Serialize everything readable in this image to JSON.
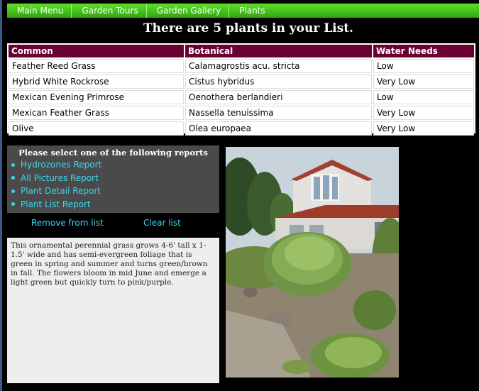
{
  "nav": {
    "items": [
      "Main Menu",
      "Garden Tours",
      "Garden Gallery",
      "Plants"
    ]
  },
  "headline": "There are 5 plants in your List.",
  "table": {
    "headers": [
      "Common",
      "Botanical",
      "Water Needs"
    ],
    "rows": [
      [
        "Feather Reed Grass",
        "Calamagrostis acu. stricta",
        "Low"
      ],
      [
        "Hybrid White Rockrose",
        "Cistus hybridus",
        "Very Low"
      ],
      [
        "Mexican Evening Primrose",
        "Oenothera berlandieri",
        "Low"
      ],
      [
        "Mexican Feather Grass",
        "Nassella tenuissima",
        "Very Low"
      ],
      [
        "Olive",
        "Olea europaea",
        "Very Low"
      ]
    ]
  },
  "reports": {
    "title": "Please select one of the following reports",
    "items": [
      "Hydrozones Report",
      "All Pictures Report",
      "Plant Detail Report",
      "Plant List Report"
    ]
  },
  "actions": {
    "remove": "Remove from list",
    "clear": "Clear list"
  },
  "description": "This ornamental perennial grass grows 4-6' tall x 1-1.5' wide and has semi-evergreen foliage that is green in spring and summer and turns green/brown in fall. The flowers bloom in mid June and emerge a light green but quickly turn to pink/purple.",
  "colors": {
    "nav": "#3fc11a",
    "table_header": "#6b0033",
    "link": "#3ed6ef",
    "panel": "#4a4a4a"
  }
}
